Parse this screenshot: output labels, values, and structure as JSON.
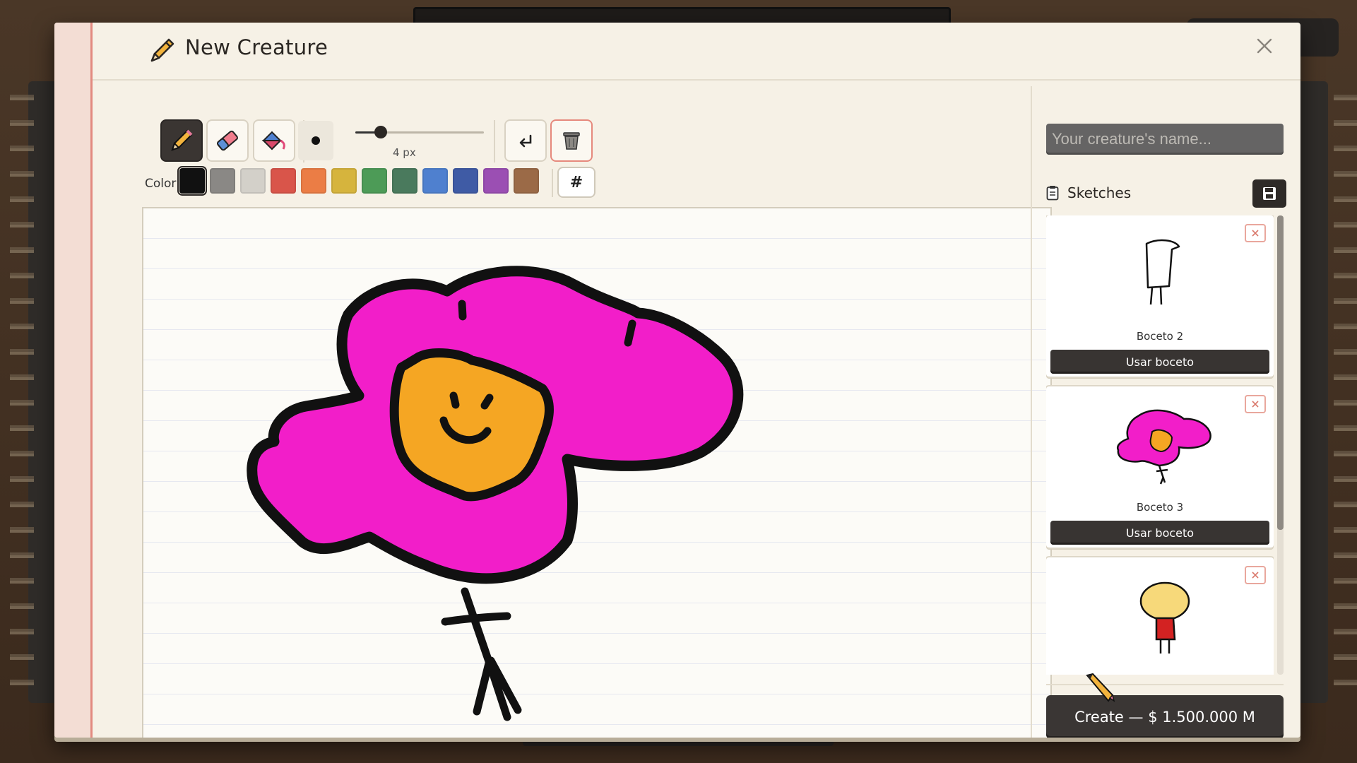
{
  "dialog": {
    "title": "New Creature",
    "close_icon": "close-icon"
  },
  "toolbar": {
    "tools": [
      {
        "name": "pencil",
        "icon": "pencil-icon",
        "active": true
      },
      {
        "name": "eraser",
        "icon": "eraser-icon",
        "active": false
      },
      {
        "name": "fill",
        "icon": "paint-bucket-icon",
        "active": false
      }
    ],
    "brush_size_label": "4 px",
    "brush_size_fraction": 0.2,
    "undo_icon": "undo-icon",
    "clear_icon": "trash-icon"
  },
  "palette": {
    "label": "Color:",
    "selected": "#111111",
    "colors": [
      "#111111",
      "#8a8885",
      "#d3d0c9",
      "#d9554a",
      "#eb7d45",
      "#d6b43d",
      "#4d9b57",
      "#4a7a5d",
      "#4f80cf",
      "#3f5ba5",
      "#9b4fb3",
      "#9b6a47"
    ],
    "custom_label": "#"
  },
  "drawing": {
    "petal_color": "#f21ec9",
    "center_color": "#f5a623",
    "stroke_color": "#111111"
  },
  "creature": {
    "name_placeholder": "Your creature's name..."
  },
  "sketches": {
    "title": "Sketches",
    "save_icon": "save-icon",
    "items": [
      {
        "name": "Boceto 2",
        "use_label": "Usar boceto"
      },
      {
        "name": "Boceto 3",
        "use_label": "Usar boceto"
      },
      {
        "name": "",
        "use_label": ""
      }
    ]
  },
  "create": {
    "label": "Create — $ 1.500.000 M"
  }
}
